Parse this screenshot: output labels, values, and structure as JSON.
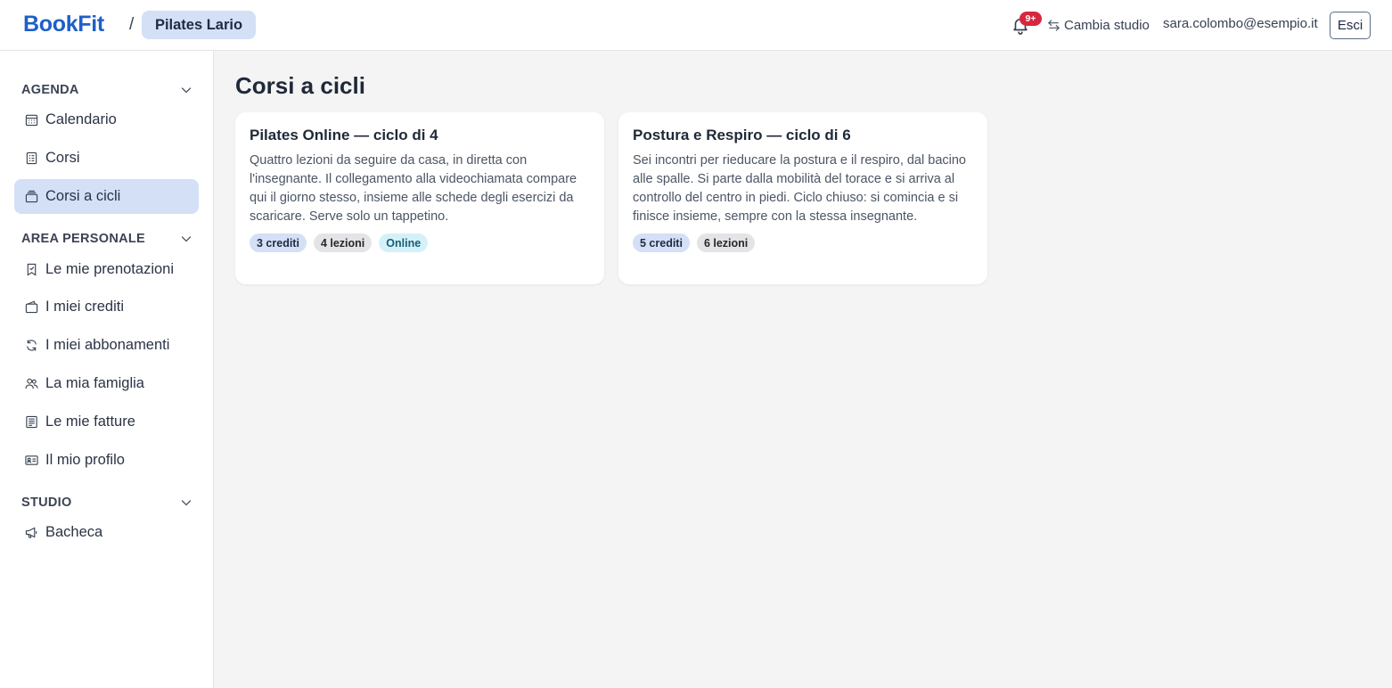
{
  "header": {
    "logo": "BookFit",
    "separator": "/",
    "studio": "Pilates Lario",
    "notifications_badge": "9+",
    "switch_studio": "Cambia studio",
    "user_email": "sara.colombo@esempio.it",
    "logout": "Esci"
  },
  "sidebar": {
    "sections": [
      {
        "title": "AGENDA",
        "items": [
          {
            "label": "Calendario",
            "icon": "calendar-icon"
          },
          {
            "label": "Corsi",
            "icon": "courses-icon"
          },
          {
            "label": "Corsi a cicli",
            "icon": "cycles-icon",
            "active": true
          }
        ]
      },
      {
        "title": "AREA PERSONALE",
        "items": [
          {
            "label": "Le mie prenotazioni",
            "icon": "bookmark-icon"
          },
          {
            "label": "I miei crediti",
            "icon": "wallet-icon"
          },
          {
            "label": "I miei abbonamenti",
            "icon": "refresh-icon"
          },
          {
            "label": "La mia famiglia",
            "icon": "family-icon"
          },
          {
            "label": "Le mie fatture",
            "icon": "invoice-icon"
          },
          {
            "label": "Il mio profilo",
            "icon": "profile-card-icon"
          }
        ]
      },
      {
        "title": "STUDIO",
        "items": [
          {
            "label": "Bacheca",
            "icon": "megaphone-icon"
          }
        ]
      }
    ]
  },
  "main": {
    "title": "Corsi a cicli",
    "cards": [
      {
        "title": "Pilates Online — ciclo di 4",
        "description": "Quattro lezioni da seguire da casa, in diretta con l'insegnante. Il collegamento alla videochiamata compare qui il giorno stesso, insieme alle schede degli esercizi da scaricare. Serve solo un tappetino.",
        "tags": [
          "3 crediti",
          "4 lezioni",
          "Online"
        ]
      },
      {
        "title": "Postura e Respiro — ciclo di 6",
        "description": "Sei incontri per rieducare la postura e il respiro, dal bacino alle spalle. Si parte dalla mobilità del torace e si arriva al controllo del centro in piedi. Ciclo chiuso: si comincia e si finisce insieme, sempre con la stessa insegnante.",
        "tags": [
          "5 crediti",
          "6 lezioni"
        ]
      }
    ]
  },
  "colors": {
    "brand": "#1f5fc7",
    "active_bg": "#d3e0f6",
    "badge": "#d7263d",
    "online_tag_bg": "#d4f1f9"
  }
}
